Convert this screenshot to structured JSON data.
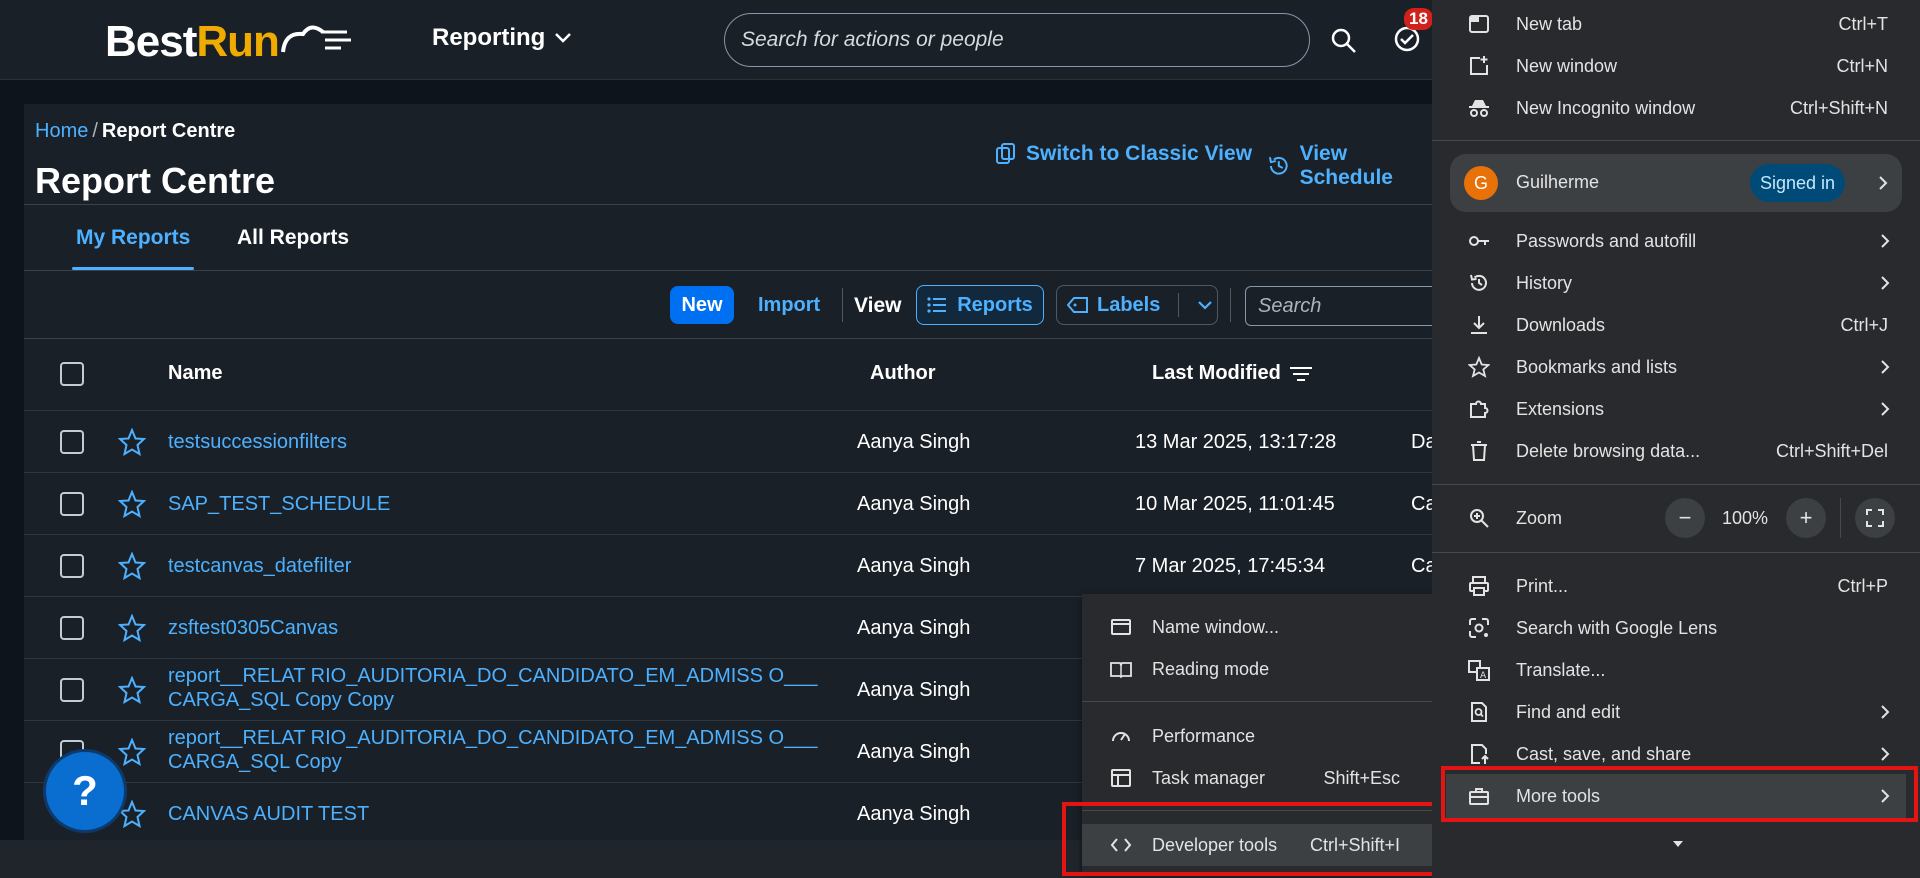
{
  "app": {
    "logo_text_best": "Best",
    "logo_text_run": "Run",
    "module_label": "Reporting",
    "search_placeholder": "Search for actions or people",
    "notification_count": "18"
  },
  "breadcrumb": {
    "home": "Home",
    "sep": "/",
    "current": "Report Centre"
  },
  "page_title": "Report Centre",
  "header_links": {
    "classic_view": "Switch to Classic View",
    "view_schedules": "View Schedule"
  },
  "tabs": [
    {
      "label": "My Reports",
      "active": true
    },
    {
      "label": "All Reports",
      "active": false
    }
  ],
  "toolbar": {
    "new_label": "New",
    "import_label": "Import",
    "view_label": "View",
    "reports_label": "Reports",
    "labels_label": "Labels",
    "search_placeholder": "Search"
  },
  "table": {
    "columns": [
      "Name",
      "Author",
      "Last Modified"
    ],
    "rows": [
      {
        "name_line1": "testsuccessionfilters",
        "name_line2": "",
        "author": "Aanya Singh",
        "modified": "13 Mar 2025, 13:17:28",
        "extra": "Da"
      },
      {
        "name_line1": "SAP_TEST_SCHEDULE",
        "name_line2": "",
        "author": "Aanya Singh",
        "modified": "10 Mar 2025, 11:01:45",
        "extra": "Ca"
      },
      {
        "name_line1": "testcanvas_datefilter",
        "name_line2": "",
        "author": "Aanya Singh",
        "modified": "7 Mar 2025, 17:45:34",
        "extra": "Ca"
      },
      {
        "name_line1": "zsftest0305Canvas",
        "name_line2": "",
        "author": "Aanya Singh",
        "modified": "",
        "extra": ""
      },
      {
        "name_line1": "report__RELAT RIO_AUDITORIA_DO_CANDIDATO_EM_ADMISS O___",
        "name_line2": "CARGA_SQL Copy Copy",
        "author": "Aanya Singh",
        "modified": "",
        "extra": ""
      },
      {
        "name_line1": "report__RELAT RIO_AUDITORIA_DO_CANDIDATO_EM_ADMISS O___",
        "name_line2": "CARGA_SQL Copy",
        "author": "Aanya Singh",
        "modified": "",
        "extra": ""
      },
      {
        "name_line1": "CANVAS AUDIT TEST",
        "name_line2": "",
        "author": "Aanya Singh",
        "modified": "",
        "extra": ""
      }
    ]
  },
  "help_label": "?",
  "chrome_menu": {
    "new_tab": {
      "label": "New tab",
      "shortcut": "Ctrl+T"
    },
    "new_window": {
      "label": "New window",
      "shortcut": "Ctrl+N"
    },
    "incognito": {
      "label": "New Incognito window",
      "shortcut": "Ctrl+Shift+N"
    },
    "profile": {
      "initial": "G",
      "name": "Guilherme",
      "status": "Signed in"
    },
    "passwords": {
      "label": "Passwords and autofill"
    },
    "history": {
      "label": "History"
    },
    "downloads": {
      "label": "Downloads",
      "shortcut": "Ctrl+J"
    },
    "bookmarks": {
      "label": "Bookmarks and lists"
    },
    "extensions": {
      "label": "Extensions"
    },
    "delete_data": {
      "label": "Delete browsing data...",
      "shortcut": "Ctrl+Shift+Del"
    },
    "zoom": {
      "label": "Zoom",
      "minus": "−",
      "value": "100%",
      "plus": "+"
    },
    "print": {
      "label": "Print...",
      "shortcut": "Ctrl+P"
    },
    "lens": {
      "label": "Search with Google Lens"
    },
    "translate": {
      "label": "Translate..."
    },
    "find_edit": {
      "label": "Find and edit"
    },
    "cast": {
      "label": "Cast, save, and share"
    },
    "more_tools": {
      "label": "More tools"
    }
  },
  "submenu": {
    "name_window": {
      "label": "Name window..."
    },
    "reading_mode": {
      "label": "Reading mode"
    },
    "performance": {
      "label": "Performance"
    },
    "task_manager": {
      "label": "Task manager",
      "shortcut": "Shift+Esc"
    },
    "dev_tools": {
      "label": "Developer tools",
      "shortcut": "Ctrl+Shift+I"
    }
  },
  "colors": {
    "accent": "#4db1ff",
    "primary_button": "#0070f2",
    "highlight_red": "#e31414",
    "brand_orange": "#f0ab00"
  }
}
